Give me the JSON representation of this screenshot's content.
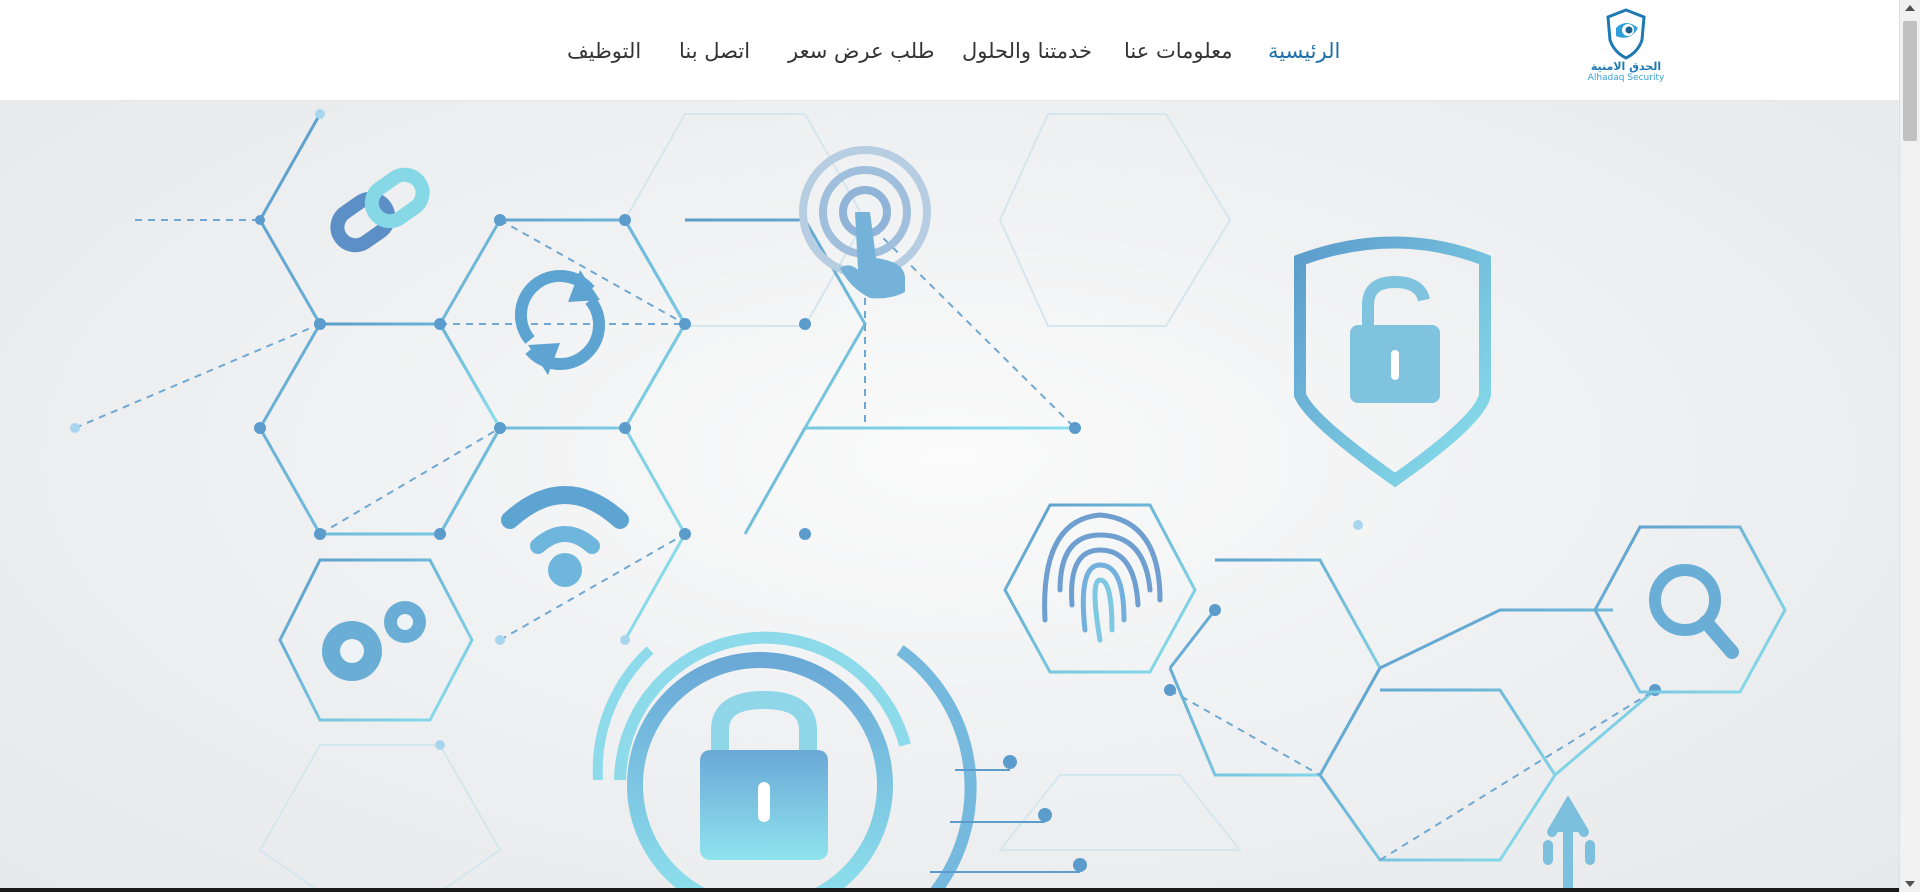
{
  "logo": {
    "text_ar": "الحدق الامنية",
    "text_en": "Alhadaq Security"
  },
  "nav": {
    "home": "الرئيسية",
    "about": "معلومات عنا",
    "services": "خدمتنا والحلول",
    "quote": "طلب عرض سعر",
    "contact": "اتصل بنا",
    "jobs": "التوظيف"
  },
  "colors": {
    "accent": "#1e6fa8",
    "hex_line": "#5fa7d4",
    "hex_cyan": "#7fd6e6",
    "icon_fill": "#6cb3d9"
  },
  "hero": {
    "icons": [
      "link-icon",
      "sync-icon",
      "touch-icon",
      "shield-lock-icon",
      "wifi-icon",
      "gears-icon",
      "fingerprint-icon",
      "search-icon",
      "padlock-icon",
      "usb-icon"
    ]
  }
}
